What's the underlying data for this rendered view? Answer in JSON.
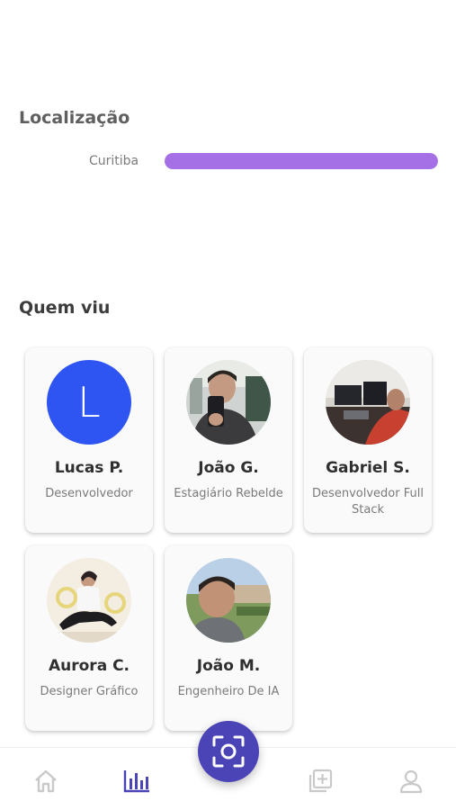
{
  "location": {
    "title": "Localização",
    "items": [
      {
        "label": "Curitiba",
        "share": 1.0
      }
    ]
  },
  "viewers": {
    "title": "Quem viu",
    "people": [
      {
        "name": "Lucas P.",
        "role": "Desenvolvedor",
        "avatar_letter": "L"
      },
      {
        "name": "João G.",
        "role": "Estagiário Rebelde"
      },
      {
        "name": "Gabriel S.",
        "role": "Desenvolvedor Full Stack"
      },
      {
        "name": "Aurora C.",
        "role": "Designer Gráfico"
      },
      {
        "name": "João M.",
        "role": "Engenheiro De IA"
      }
    ]
  },
  "nav": {
    "items": [
      {
        "icon": "home-icon",
        "active": false
      },
      {
        "icon": "bar-chart-icon",
        "active": true
      },
      {
        "icon": "scan-icon",
        "active": false
      },
      {
        "icon": "add-post-icon",
        "active": false
      },
      {
        "icon": "profile-icon",
        "active": false
      }
    ]
  },
  "colors": {
    "accent": "#4b44b7",
    "bar": "#a56fe6",
    "avatar_bg": "#2e54f2",
    "nav_inactive": "#c9c9c9"
  }
}
